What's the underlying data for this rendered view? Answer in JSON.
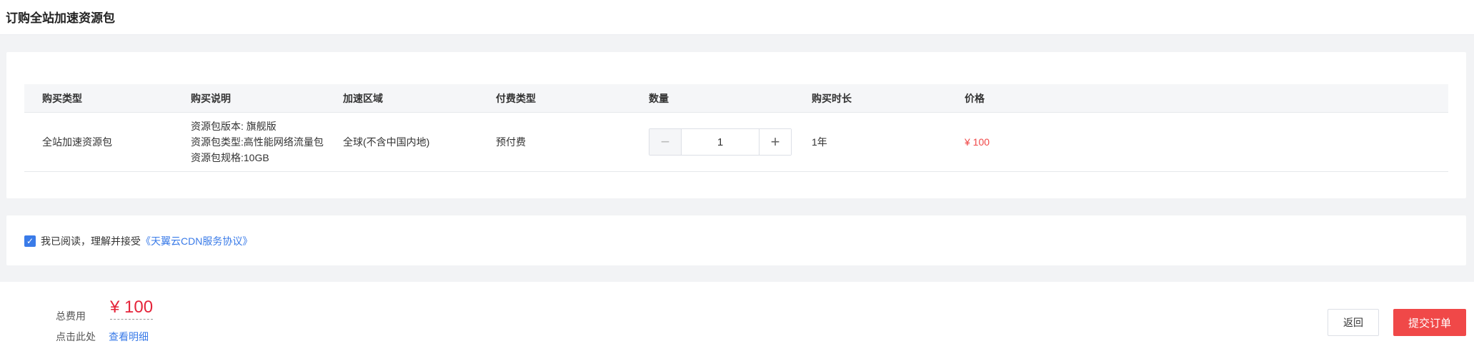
{
  "header": {
    "title": "订购全站加速资源包"
  },
  "table": {
    "columns": [
      "购买类型",
      "购买说明",
      "加速区域",
      "付费类型",
      "数量",
      "购买时长",
      "价格"
    ],
    "row": {
      "type": "全站加速资源包",
      "desc": [
        "资源包版本: 旗舰版",
        "资源包类型:高性能网络流量包",
        "资源包规格:10GB"
      ],
      "region": "全球(不含中国内地)",
      "pay_type": "预付费",
      "quantity": "1",
      "duration": "1年",
      "price": "¥ 100"
    }
  },
  "agreement": {
    "checked": true,
    "text": "我已阅读，理解并接受",
    "link": "《天翼云CDN服务协议》"
  },
  "footer": {
    "total_label": "总费用",
    "total_value": "¥ 100",
    "detail_prefix": "点击此处",
    "detail_link": "查看明细",
    "back_label": "返回",
    "submit_label": "提交订单"
  },
  "colors": {
    "accent": "#3a7be8",
    "danger": "#f04848",
    "price": "#e5243a"
  },
  "icons": {
    "checkbox": "check-icon",
    "minus": "minus-icon",
    "plus": "plus-icon"
  }
}
